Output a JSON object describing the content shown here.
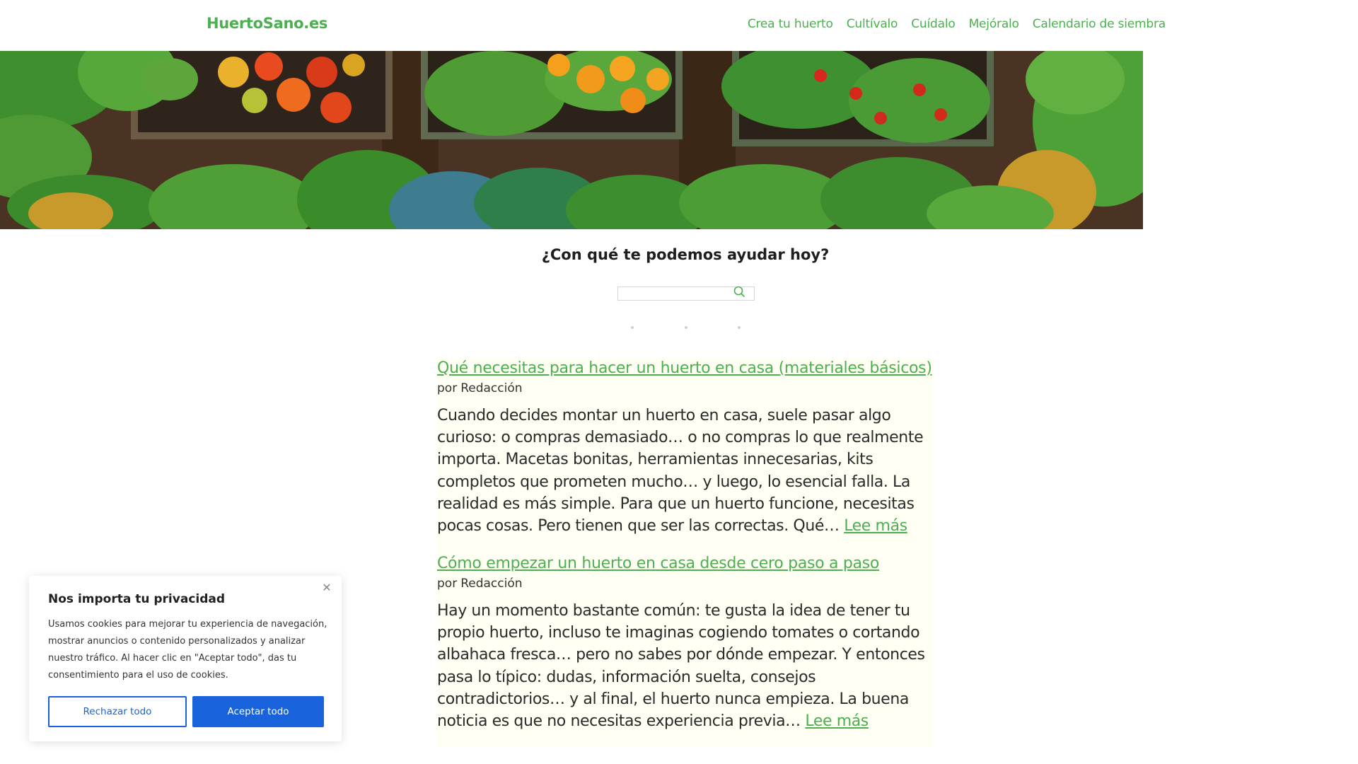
{
  "header": {
    "brand": "HuertoSano.es",
    "nav": [
      "Crea tu huerto",
      "Cultívalo",
      "Cuídalo",
      "Mejóralo",
      "Calendario de siembra"
    ]
  },
  "hero": {
    "image_description": ""
  },
  "help": {
    "title": "¿Con qué te podemos ayudar hoy?",
    "search_placeholder": "",
    "search_icon": "search-icon"
  },
  "articles": [
    {
      "title": "Qué necesitas para hacer un huerto en casa (materiales básicos)",
      "author_prefix": "por",
      "author": "Redacción",
      "excerpt": "Cuando decides montar un huerto en casa, suele pasar algo curioso: o compras demasiado… o no compras lo que realmente importa. Macetas bonitas, herramientas innecesarias, kits completos que prometen mucho… y luego, lo esencial falla. La realidad es más simple. Para que un huerto funcione, necesitas pocas cosas. Pero tienen que ser las correctas. Qué…",
      "read_more": "Lee más"
    },
    {
      "title": "Cómo empezar un huerto en casa desde cero paso a paso",
      "author_prefix": "por",
      "author": "Redacción",
      "excerpt": "Hay un momento bastante común: te gusta la idea de tener tu propio huerto, incluso te imaginas cogiendo tomates o cortando albahaca fresca… pero no sabes por dónde empezar. Y entonces pasa lo típico: dudas, información suelta, consejos contradictorios… y al final, el huerto nunca empieza. La buena noticia es que no necesitas experiencia previa…",
      "read_more": "Lee más"
    }
  ],
  "cookie": {
    "title": "Nos importa tu privacidad",
    "text": "Usamos cookies para mejorar tu experiencia de navegación, mostrar anuncios o contenido personalizados y analizar nuestro tráfico. Al hacer clic en \"Aceptar todo\", das tu consentimiento para el uso de cookies.",
    "reject_label": "Rechazar todo",
    "accept_label": "Aceptar todo",
    "close_icon": "close-icon"
  },
  "colors": {
    "brand_green": "#4caf50",
    "button_blue": "#1863dc",
    "article_bg": "#fffff3"
  }
}
